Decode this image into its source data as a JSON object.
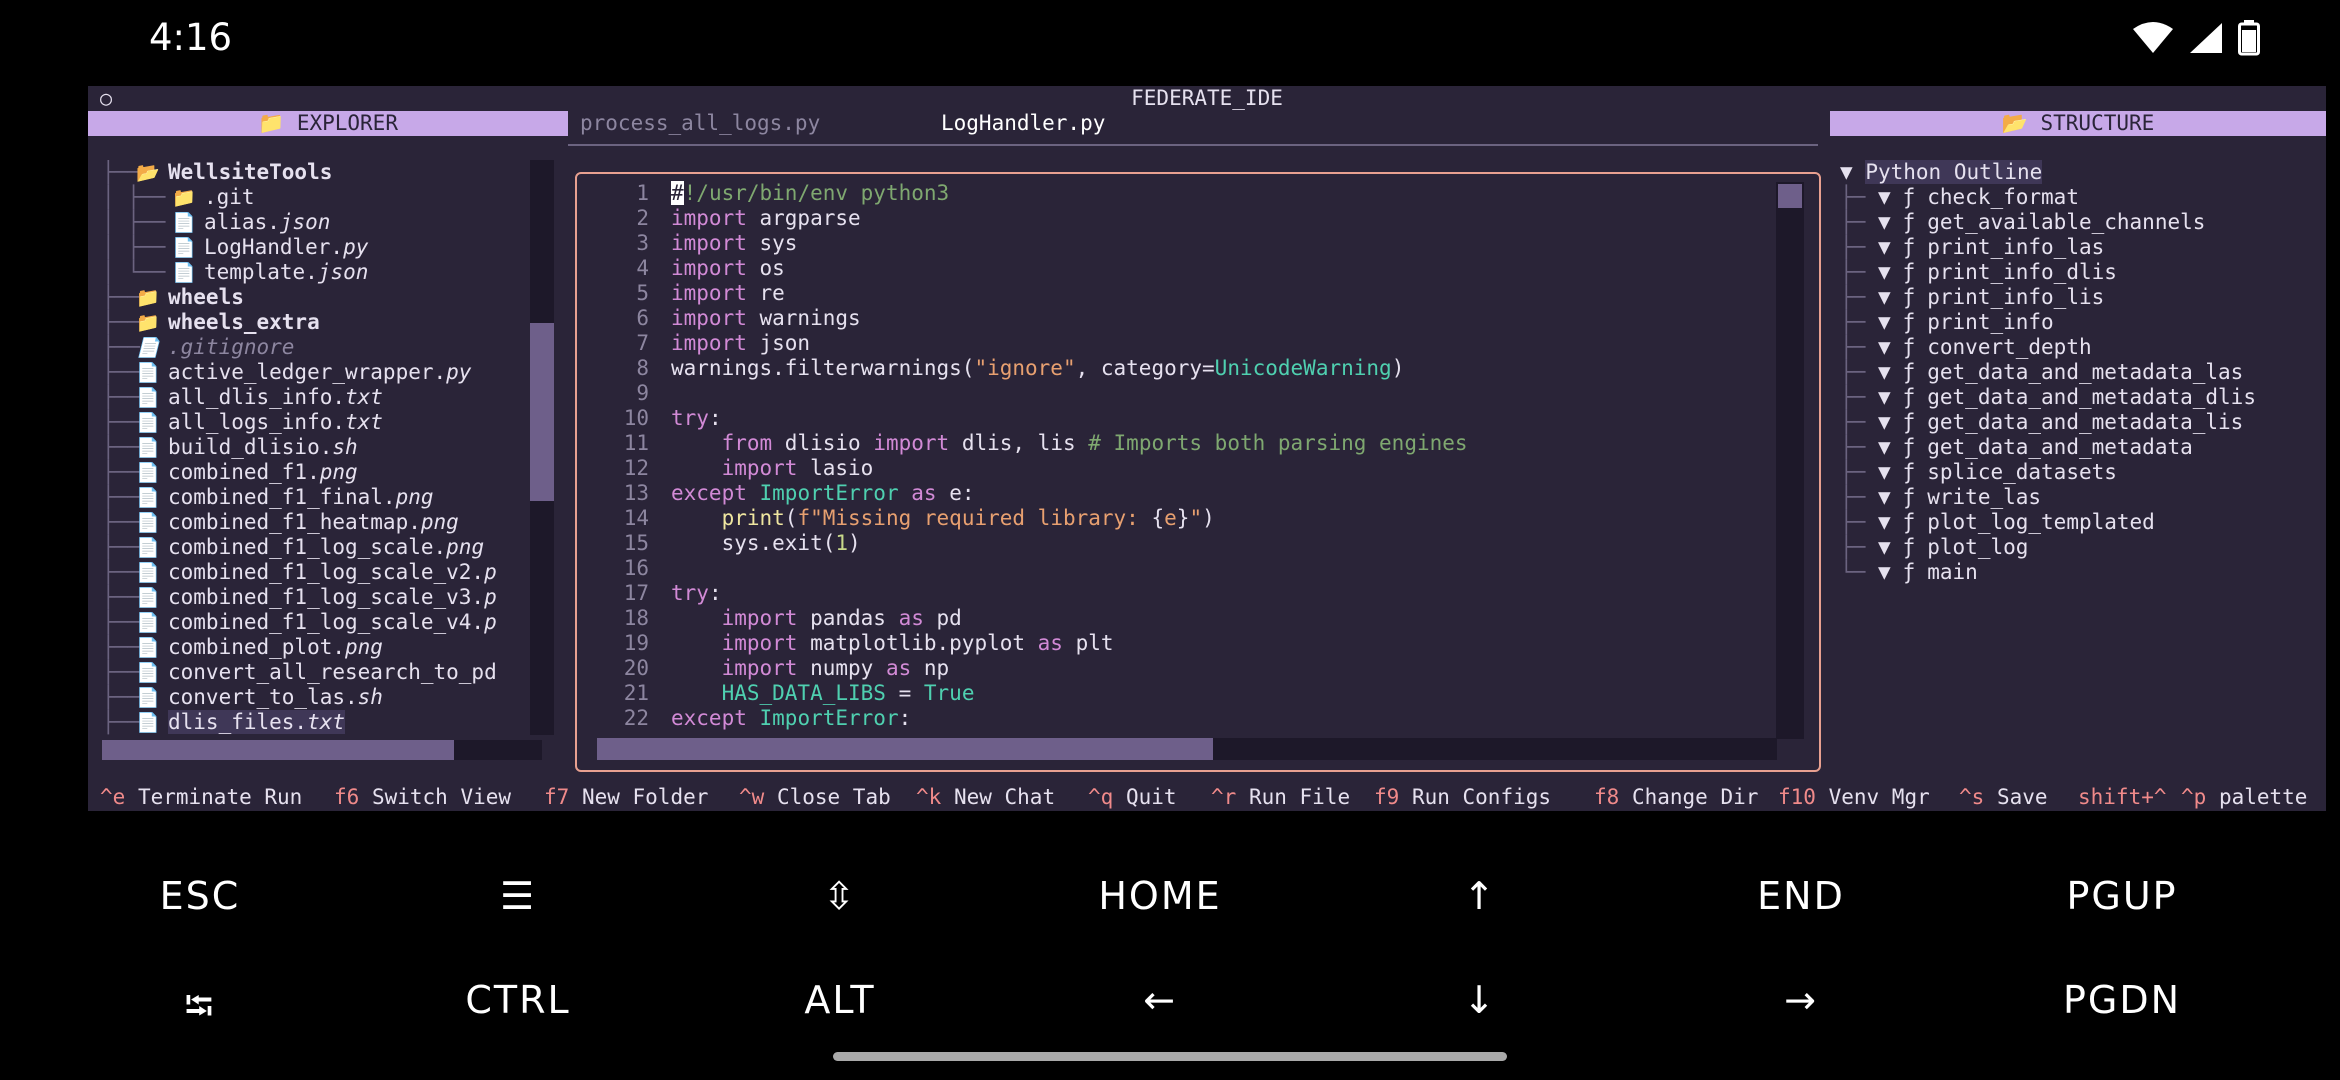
{
  "status": {
    "time": "4:16"
  },
  "window": {
    "title": "FEDERATE_IDE",
    "dot": "○"
  },
  "explorer": {
    "header": "📁  EXPLORER",
    "items": [
      {
        "guide": "├──",
        "icon": "📂",
        "name": "WellsiteTools",
        "ext": "",
        "type": "dir",
        "indent": 0
      },
      {
        "guide": "│   ├──",
        "icon": "📁",
        "name": ".git",
        "ext": "",
        "type": "dir2",
        "indent": 1
      },
      {
        "guide": "│   ├──",
        "icon": "📄",
        "name": "alias.",
        "ext": "json",
        "type": "file",
        "indent": 1
      },
      {
        "guide": "│   ├──",
        "icon": "📄",
        "name": "LogHandler.",
        "ext": "py",
        "type": "file",
        "indent": 1
      },
      {
        "guide": "│   └──",
        "icon": "📄",
        "name": "template.",
        "ext": "json",
        "type": "file",
        "indent": 1
      },
      {
        "guide": "├──",
        "icon": "📁",
        "name": "wheels",
        "ext": "",
        "type": "dir",
        "indent": 0
      },
      {
        "guide": "├──",
        "icon": "📁",
        "name": "wheels_extra",
        "ext": "",
        "type": "dir",
        "indent": 0
      },
      {
        "guide": "├──",
        "icon": "📄",
        "name": ".gitignore",
        "ext": "",
        "type": "dim",
        "indent": 0
      },
      {
        "guide": "├──",
        "icon": "📄",
        "name": "active_ledger_wrapper.",
        "ext": "py",
        "type": "file",
        "indent": 0
      },
      {
        "guide": "├──",
        "icon": "📄",
        "name": "all_dlis_info.",
        "ext": "txt",
        "type": "file",
        "indent": 0
      },
      {
        "guide": "├──",
        "icon": "📄",
        "name": "all_logs_info.",
        "ext": "txt",
        "type": "file",
        "indent": 0
      },
      {
        "guide": "├──",
        "icon": "📄",
        "name": "build_dlisio.",
        "ext": "sh",
        "type": "file",
        "indent": 0
      },
      {
        "guide": "├──",
        "icon": "📄",
        "name": "combined_f1.",
        "ext": "png",
        "type": "file",
        "indent": 0
      },
      {
        "guide": "├──",
        "icon": "📄",
        "name": "combined_f1_final.",
        "ext": "png",
        "type": "file",
        "indent": 0
      },
      {
        "guide": "├──",
        "icon": "📄",
        "name": "combined_f1_heatmap.",
        "ext": "png",
        "type": "file",
        "indent": 0
      },
      {
        "guide": "├──",
        "icon": "📄",
        "name": "combined_f1_log_scale.",
        "ext": "png",
        "type": "file",
        "indent": 0
      },
      {
        "guide": "├──",
        "icon": "📄",
        "name": "combined_f1_log_scale_v2.",
        "ext": "p",
        "type": "file",
        "indent": 0
      },
      {
        "guide": "├──",
        "icon": "📄",
        "name": "combined_f1_log_scale_v3.",
        "ext": "p",
        "type": "file",
        "indent": 0
      },
      {
        "guide": "├──",
        "icon": "📄",
        "name": "combined_f1_log_scale_v4.",
        "ext": "p",
        "type": "file",
        "indent": 0
      },
      {
        "guide": "├──",
        "icon": "📄",
        "name": "combined_plot.",
        "ext": "png",
        "type": "file",
        "indent": 0
      },
      {
        "guide": "├──",
        "icon": "📄",
        "name": "convert_all_research_to_pd",
        "ext": "",
        "type": "file",
        "indent": 0
      },
      {
        "guide": "├──",
        "icon": "📄",
        "name": "convert_to_las.",
        "ext": "sh",
        "type": "file",
        "indent": 0
      },
      {
        "guide": "├──",
        "icon": "📄",
        "name": "dlis_files.",
        "ext": "txt",
        "type": "sel",
        "indent": 0
      }
    ]
  },
  "editor": {
    "tabs": [
      {
        "label": "process_all_logs.py",
        "active": false
      },
      {
        "label": "LogHandler.py",
        "active": true
      }
    ]
  },
  "structure": {
    "header": "📂  STRUCTURE",
    "root_toggle": "▼",
    "root": "Python Outline",
    "functions": [
      "check_format",
      "get_available_channels",
      "print_info_las",
      "print_info_dlis",
      "print_info_lis",
      "print_info",
      "convert_depth",
      "get_data_and_metadata_las",
      "get_data_and_metadata_dlis",
      "get_data_and_metadata_lis",
      "get_data_and_metadata",
      "splice_datasets",
      "write_las",
      "plot_log_templated",
      "plot_log",
      "main"
    ],
    "fn_icon": "ƒ",
    "fn_toggle": "▼"
  },
  "shortcuts": [
    {
      "key": "^e",
      "label": "Terminate Run"
    },
    {
      "key": "f6",
      "label": "Switch View"
    },
    {
      "key": "f7",
      "label": "New Folder"
    },
    {
      "key": "^w",
      "label": "Close Tab"
    },
    {
      "key": "^k",
      "label": "New Chat"
    },
    {
      "key": "^q",
      "label": "Quit"
    },
    {
      "key": "^r",
      "label": "Run File"
    },
    {
      "key": "f9",
      "label": "Run Configs"
    },
    {
      "key": "f8",
      "label": "Change Dir"
    },
    {
      "key": "f10",
      "label": "Venv Mgr"
    },
    {
      "key": "^s",
      "label": "Save"
    },
    {
      "key": "shift+^",
      "label": ""
    },
    {
      "key": "^p",
      "label": "palette"
    }
  ],
  "extra_keys": {
    "row1": [
      "ESC",
      "☰",
      "⇳",
      "HOME",
      "↑",
      "END",
      "PGUP"
    ],
    "row2": [
      "⭾",
      "CTRL",
      "ALT",
      "←",
      "↓",
      "→",
      "PGDN"
    ]
  }
}
